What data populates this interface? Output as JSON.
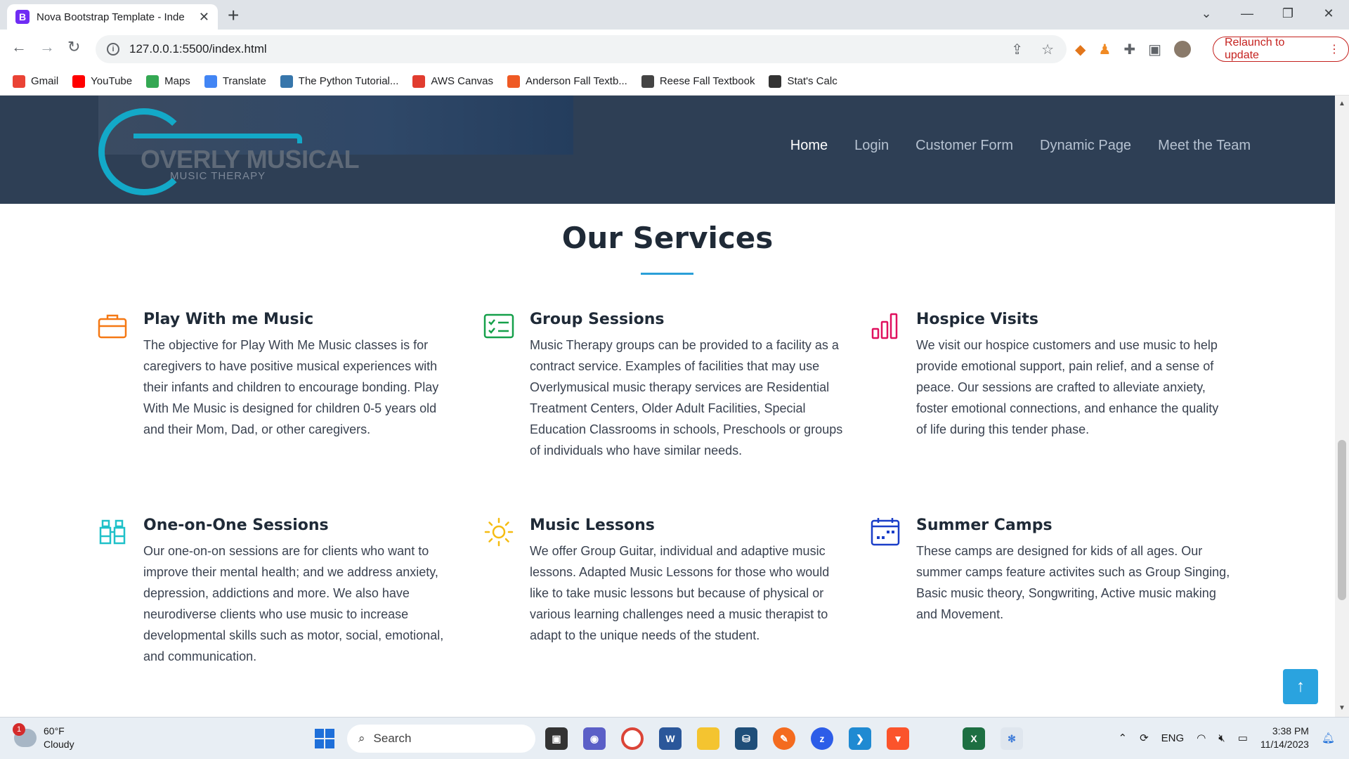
{
  "browser": {
    "tab_title": "Nova Bootstrap Template - Inde",
    "favicon": "B",
    "url": "127.0.0.1:5500/index.html",
    "relaunch_label": "Relaunch to update",
    "bookmarks": [
      {
        "label": "Gmail",
        "icon": "gmail-icon",
        "color": "#ea4335"
      },
      {
        "label": "YouTube",
        "icon": "youtube-icon",
        "color": "#ff0000"
      },
      {
        "label": "Maps",
        "icon": "maps-icon",
        "color": "#34a853"
      },
      {
        "label": "Translate",
        "icon": "translate-icon",
        "color": "#4285f4"
      },
      {
        "label": "The Python Tutorial...",
        "icon": "python-icon",
        "color": "#3776ab"
      },
      {
        "label": "AWS Canvas",
        "icon": "canvas-icon",
        "color": "#e13c2f"
      },
      {
        "label": "Anderson Fall Textb...",
        "icon": "textbook-icon",
        "color": "#ef5a24"
      },
      {
        "label": "Reese Fall Textbook",
        "icon": "globe-icon",
        "color": "#444444"
      },
      {
        "label": "Stat's Calc",
        "icon": "calc-icon",
        "color": "#333333"
      }
    ]
  },
  "site": {
    "logo_title": "OVERLY MUSICAL",
    "logo_subtitle": "MUSIC THERAPY",
    "nav": [
      "Home",
      "Login",
      "Customer Form",
      "Dynamic Page",
      "Meet the Team"
    ],
    "active_nav": "Home",
    "section_title": "Our Services",
    "services": [
      {
        "title": "Play With me Music",
        "icon": "briefcase-icon",
        "color": "#f57813",
        "text": "The objective for Play With Me Music classes is for caregivers to have positive musical experiences with their infants and children to encourage bonding. Play With Me Music is designed for children 0-5 years old and their Mom, Dad, or other caregivers."
      },
      {
        "title": "Group Sessions",
        "icon": "card-checklist-icon",
        "color": "#15a04a",
        "text": "Music Therapy groups can be provided to a facility as a contract service. Examples of facilities that may use Overlymusical music therapy services are Residential Treatment Centers, Older Adult Facilities, Special Education Classrooms in schools, Preschools or groups of individuals who have similar needs."
      },
      {
        "title": "Hospice Visits",
        "icon": "bar-chart-icon",
        "color": "#e0115f",
        "text": "We visit our hospice customers and use music to help provide emotional support, pain relief, and a sense of peace. Our sessions are crafted to alleviate anxiety, foster emotional connections, and enhance the quality of life during this tender phase."
      },
      {
        "title": "One-on-One Sessions",
        "icon": "binoculars-icon",
        "color": "#20c1c9",
        "text": "Our one-on-on sessions are for clients who want to improve their mental health; and we address anxiety, depression, addictions and more. We also have neurodiverse clients who use music to increase developmental skills such as motor, social, emotional, and communication."
      },
      {
        "title": "Music Lessons",
        "icon": "sun-icon",
        "color": "#f5bc12",
        "text": "We offer Group Guitar, individual and adaptive music lessons. Adapted Music Lessons for those who would like to take music lessons but because of physical or various learning challenges need a music therapist to adapt to the unique needs of the student."
      },
      {
        "title": "Summer Camps",
        "icon": "calendar-icon",
        "color": "#1a3ec8",
        "text": "These camps are designed for kids of all ages. Our summer camps feature activites such as Group Singing, Basic music theory, Songwriting, Active music making and Movement."
      }
    ]
  },
  "taskbar": {
    "weather_temp": "60°F",
    "weather_desc": "Cloudy",
    "weather_badge": "1",
    "search_label": "Search",
    "language": "ENG",
    "time": "3:38 PM",
    "date": "11/14/2023"
  }
}
